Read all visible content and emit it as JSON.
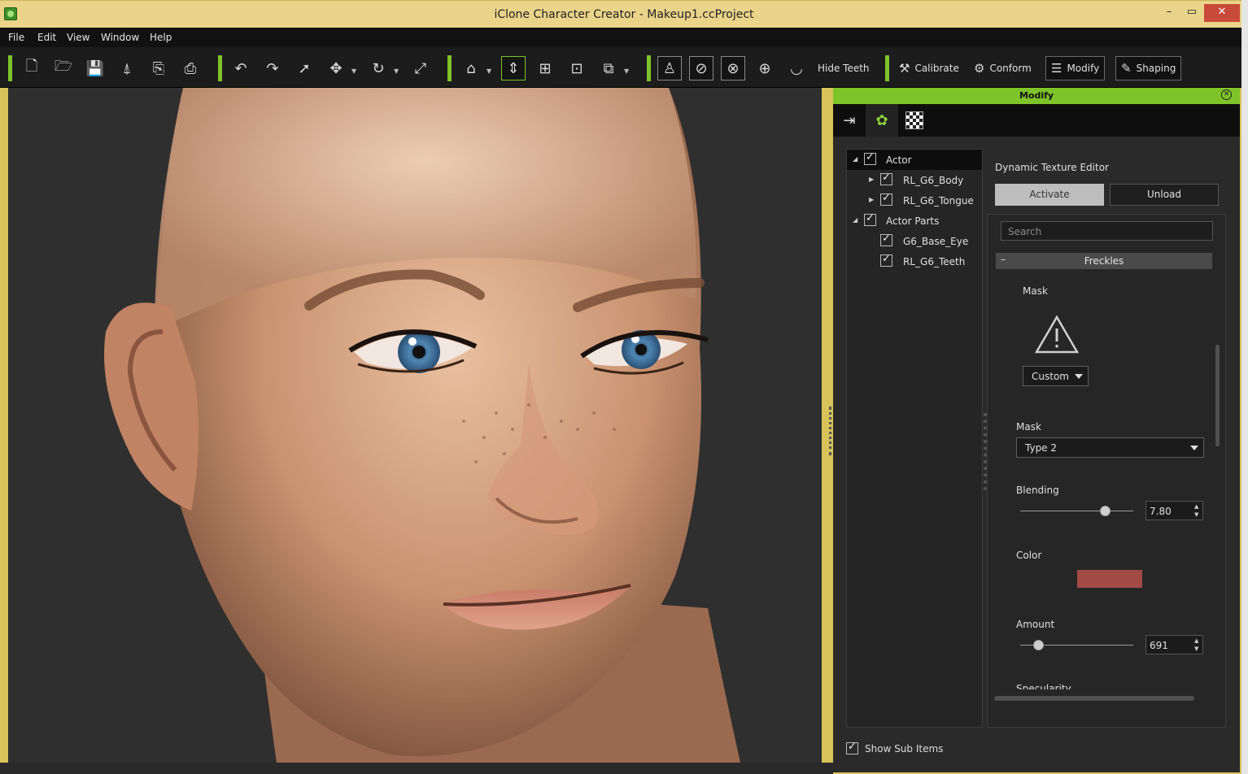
{
  "window": {
    "title": "iClone Character Creator - Makeup1.ccProject",
    "min": "–",
    "max": "▭",
    "close": "✕"
  },
  "menu": [
    "File",
    "Edit",
    "View",
    "Window",
    "Help"
  ],
  "toolbar": {
    "hide_teeth": "Hide Teeth",
    "calibrate": "Calibrate",
    "conform": "Conform",
    "modify": "Modify",
    "shaping": "Shaping"
  },
  "panel": {
    "title": "Modify",
    "tree": [
      {
        "label": "Actor",
        "checked": true,
        "expanded": true
      },
      {
        "label": "RL_G6_Body",
        "checked": true
      },
      {
        "label": "RL_G6_Tongue",
        "checked": true
      },
      {
        "label": "Actor Parts",
        "checked": true,
        "expanded": true
      },
      {
        "label": "G6_Base_Eye",
        "checked": true
      },
      {
        "label": "RL_G6_Teeth",
        "checked": true
      }
    ],
    "show_sub_items": "Show Sub Items",
    "dte_title": "Dynamic Texture Editor",
    "activate": "Activate",
    "unload": "Unload",
    "search_placeholder": "Search",
    "section": "Freckles",
    "mask_label_1": "Mask",
    "mask_preset": "Custom",
    "mask_label_2": "Mask",
    "mask_type": "Type 2",
    "blending_label": "Blending",
    "blending_value": "7.80",
    "blending_fraction": 0.75,
    "color_label": "Color",
    "color_value": "#a24a46",
    "amount_label": "Amount",
    "amount_value": "691",
    "amount_fraction": 0.16,
    "specularity_label": "Specularity"
  }
}
